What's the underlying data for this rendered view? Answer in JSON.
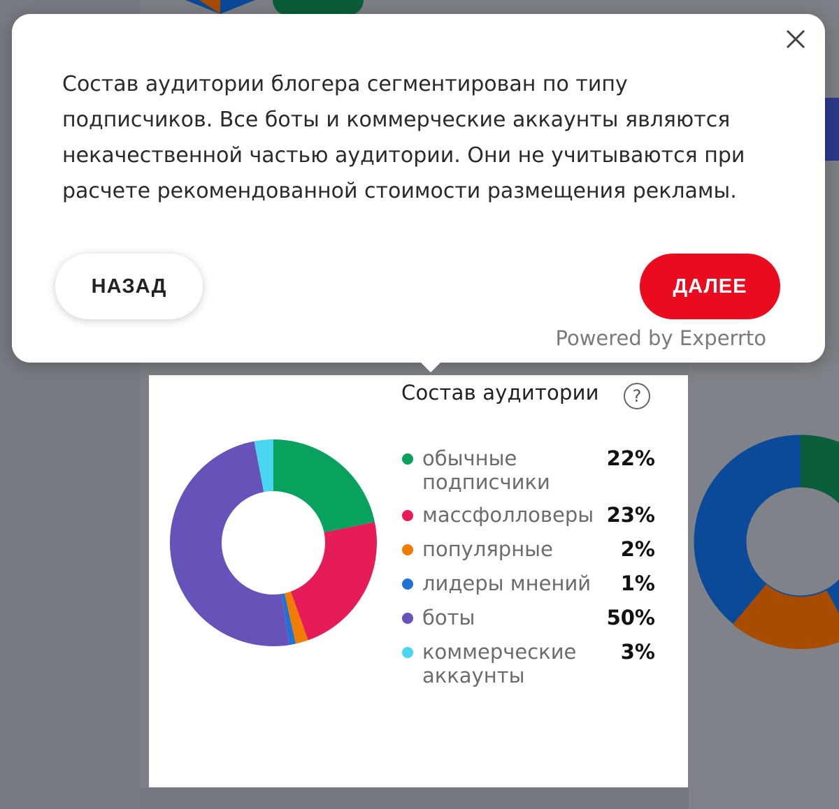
{
  "tour": {
    "text": "Состав аудитории блогера сегментирован по типу подписчиков. Все боты и коммерческие аккаунты являются некачественной частью аудитории. Они не учитываются при расчете рекомендованной стоимости размещения рекламы.",
    "back_label": "НАЗАД",
    "next_label": "ДАЛЕЕ",
    "powered_by": "Powered by Experrto",
    "close_icon": "close-icon"
  },
  "card": {
    "title": "Состав аудитории",
    "help_symbol": "?",
    "help_icon": "question-circle-icon"
  },
  "chart_data": {
    "type": "pie",
    "categories": [
      "обычные подписчики",
      "массфолловеры",
      "популярные",
      "лидеры мнений",
      "боты",
      "коммерческие аккаунты"
    ],
    "values": [
      22,
      23,
      2,
      1,
      50,
      3
    ],
    "value_labels": [
      "22%",
      "23%",
      "2%",
      "1%",
      "50%",
      "3%"
    ],
    "colors": [
      "#08a15d",
      "#e51c58",
      "#f07c00",
      "#1f73d6",
      "#6652b8",
      "#4ad6f0"
    ],
    "legend": "right",
    "donut": true
  },
  "background": {
    "colors": [
      "#0b5e3a",
      "#0a4a99",
      "#a84c00"
    ]
  }
}
